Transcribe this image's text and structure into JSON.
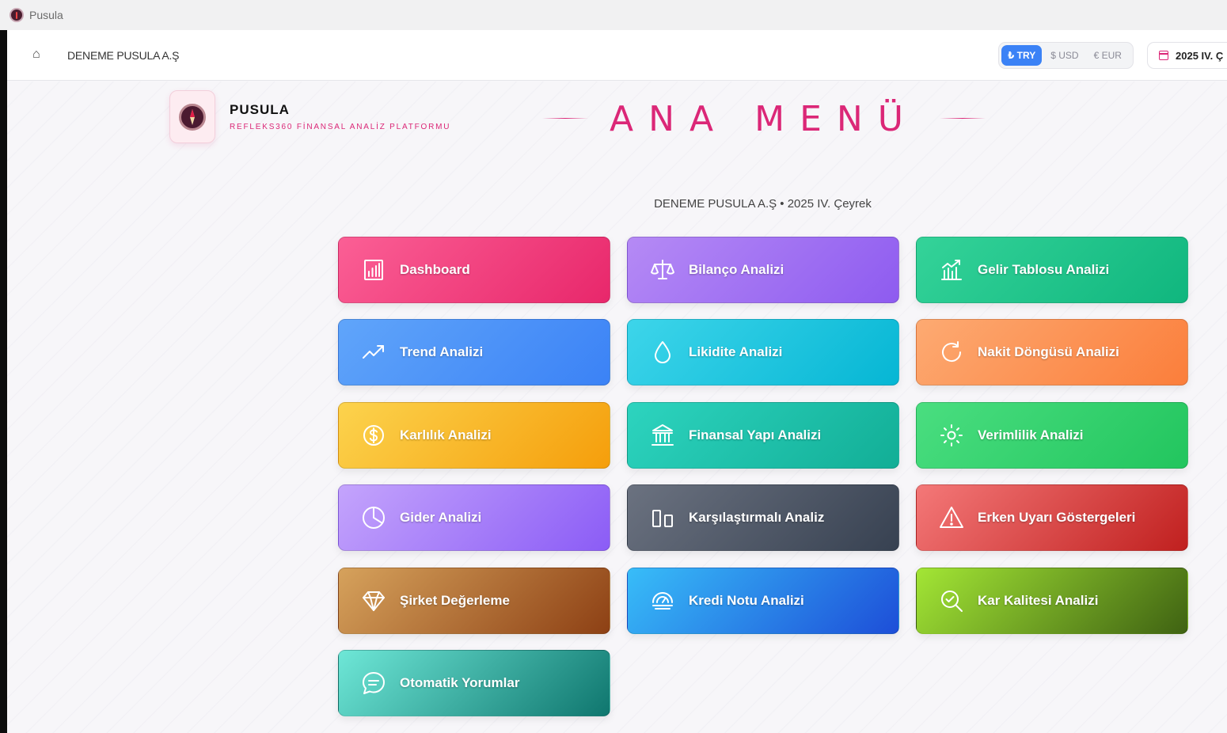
{
  "window": {
    "title": "Pusula"
  },
  "topbar": {
    "company": "DENEME PUSULA A.Ş",
    "currencies": [
      "₺ TRY",
      "$ USD",
      "€ EUR"
    ],
    "period": "2025 IV. Ç"
  },
  "brand": {
    "name": "PUSULA",
    "subtitle": "REFLEKS360 FİNANSAL ANALİZ PLATFORMU"
  },
  "page": {
    "heading": "ANA MENÜ",
    "subtitle": "DENEME PUSULA A.Ş • 2025 IV. Çeyrek"
  },
  "menu": [
    {
      "label": "Dashboard",
      "icon": "bar-chart-icon",
      "colors": [
        "#fb5f95",
        "#e8276b"
      ]
    },
    {
      "label": "Bilanço Analizi",
      "icon": "scale-icon",
      "colors": [
        "#b58af5",
        "#8e5bf0"
      ]
    },
    {
      "label": "Gelir Tablosu Analizi",
      "icon": "chart-growth-icon",
      "colors": [
        "#34d399",
        "#10b67e"
      ]
    },
    {
      "label": "Trend Analizi",
      "icon": "trend-up-icon",
      "colors": [
        "#60a5fa",
        "#3b82f6"
      ]
    },
    {
      "label": "Likidite Analizi",
      "icon": "droplet-icon",
      "colors": [
        "#3dd5ea",
        "#06b6d4"
      ]
    },
    {
      "label": "Nakit Döngüsü Analizi",
      "icon": "refresh-icon",
      "colors": [
        "#fdaa72",
        "#fb7e3b"
      ]
    },
    {
      "label": "Karlılık Analizi",
      "icon": "dollar-icon",
      "colors": [
        "#fcd34d",
        "#f59e0b"
      ]
    },
    {
      "label": "Finansal Yapı Analizi",
      "icon": "bank-icon",
      "colors": [
        "#2dd4bf",
        "#12ae96"
      ]
    },
    {
      "label": "Verimlilik Analizi",
      "icon": "sun-icon",
      "colors": [
        "#4ade80",
        "#22c55e"
      ]
    },
    {
      "label": "Gider Analizi",
      "icon": "pie-chart-icon",
      "colors": [
        "#c4a4fc",
        "#8b5cf6"
      ]
    },
    {
      "label": "Karşılaştırmalı Analiz",
      "icon": "compare-icon",
      "colors": [
        "#6b7280",
        "#374151"
      ]
    },
    {
      "label": "Erken Uyarı Göstergeleri",
      "icon": "warning-icon",
      "colors": [
        "#f47878",
        "#c0201f"
      ]
    },
    {
      "label": "Şirket Değerleme",
      "icon": "diamond-icon",
      "colors": [
        "#d6a25c",
        "#8d4014"
      ]
    },
    {
      "label": "Kredi Notu Analizi",
      "icon": "gauge-icon",
      "colors": [
        "#38bdf8",
        "#1d4ed8"
      ]
    },
    {
      "label": "Kar Kalitesi Analizi",
      "icon": "search-check-icon",
      "colors": [
        "#a3e635",
        "#3f6212"
      ]
    },
    {
      "label": "Otomatik Yorumlar",
      "icon": "chat-icon",
      "colors": [
        "#6ee7d7",
        "#0f766e"
      ]
    }
  ]
}
